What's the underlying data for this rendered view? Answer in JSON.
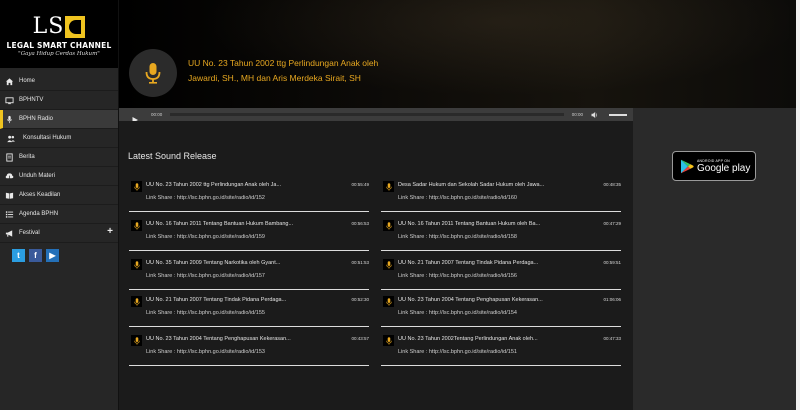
{
  "logo": {
    "letters": "LS",
    "name": "LEGAL SMART CHANNEL",
    "tagline": "\"Gaya Hidup Cerdas Hukum\""
  },
  "nav": [
    {
      "label": "Home",
      "icon": "home-icon"
    },
    {
      "label": "BPHNTV",
      "icon": "tv-icon"
    },
    {
      "label": "BPHN Radio",
      "icon": "microphone-icon"
    },
    {
      "label": "Konsultasi Hukum",
      "icon": "people-icon"
    },
    {
      "label": "Berita",
      "icon": "document-icon"
    },
    {
      "label": "Unduh Materi",
      "icon": "download-icon"
    },
    {
      "label": "Akses Keadilan",
      "icon": "book-icon"
    },
    {
      "label": "Agenda BPHN",
      "icon": "list-icon"
    },
    {
      "label": "Festival",
      "icon": "megaphone-icon",
      "plus": "+"
    }
  ],
  "social": {
    "twitter": "t",
    "facebook": "f",
    "youtube": "▶"
  },
  "header": {
    "title": "UU No. 23 Tahun 2002 ttg Perlindungan Anak oleh Jawardi, SH., MH dan Aris Merdeka Sirait, SH"
  },
  "player": {
    "current": "00:00",
    "duration": "00:00",
    "progress": 0,
    "volume": 1.0
  },
  "main": {
    "section_title": "Latest Sound Release",
    "tracks": [
      {
        "title": "UU No. 23 Tahun 2002 ttg Perlindungan Anak oleh Ja...",
        "time": "00:55:49",
        "link": "Link Share : http://lsc.bphn.go.id/site/radio/id/152"
      },
      {
        "title": "Desa Sadar Hukum dan Sekolah Sadar Hukum oleh Jawa...",
        "time": "00:48:35",
        "link": "Link Share : http://lsc.bphn.go.id/site/radio/id/160"
      },
      {
        "title": "UU No. 16 Tahun 2011 Tentang Bantuan Hukum Bambang...",
        "time": "00:56:53",
        "link": "Link Share : http://lsc.bphn.go.id/site/radio/id/159"
      },
      {
        "title": "UU No. 16 Tahun 2011 Tentang Bantuan Hukum oleh Ba...",
        "time": "00:47:29",
        "link": "Link Share : http://lsc.bphn.go.id/site/radio/id/158"
      },
      {
        "title": "UU No. 35 Tahun 2009 Tentang Narkotika oleh Gyant...",
        "time": "00:51:53",
        "link": "Link Share : http://lsc.bphn.go.id/site/radio/id/157"
      },
      {
        "title": "UU No. 21 Tahun 2007 Tentang Tindak Pidana Perdaga...",
        "time": "00:59:51",
        "link": "Link Share : http://lsc.bphn.go.id/site/radio/id/156"
      },
      {
        "title": "UU No. 21 Tahun 2007 Tentang Tindak Pidana Perdaga...",
        "time": "00:52:30",
        "link": "Link Share : http://lsc.bphn.go.id/site/radio/id/155"
      },
      {
        "title": "UU No. 23 Tahun 2004 Tentang Penghapusan Kekerasan...",
        "time": "01:06:06",
        "link": "Link Share : http://lsc.bphn.go.id/site/radio/id/154"
      },
      {
        "title": "UU No. 23 Tahun 2004 Tentang Penghapusan Kekerasan...",
        "time": "00:43:57",
        "link": "Link Share : http://lsc.bphn.go.id/site/radio/id/153"
      },
      {
        "title": "UU No. 23 Tahun 2002Tentang Perlindungan Anak oleh...",
        "time": "00:47:33",
        "link": "Link Share : http://lsc.bphn.go.id/site/radio/id/151"
      }
    ]
  },
  "store": {
    "small": "ANDROID APP ON",
    "big": "Google play"
  },
  "colors": {
    "accent": "#f0c420",
    "title": "#e8a820",
    "sidebar": "#262626",
    "background": "#1b1b1b"
  }
}
